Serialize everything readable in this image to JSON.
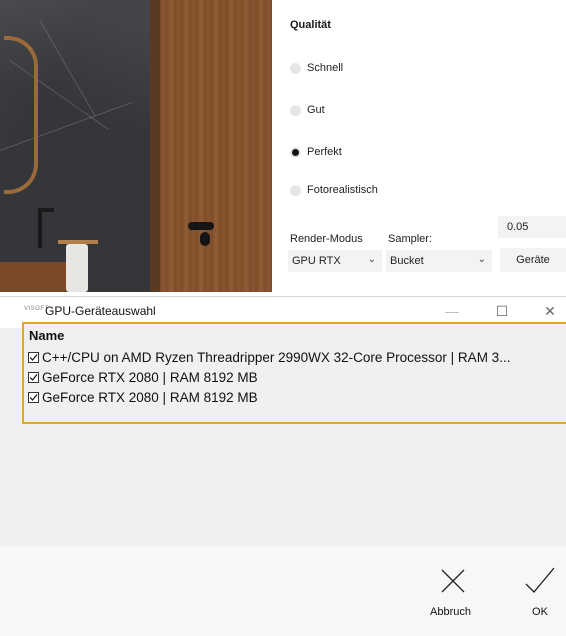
{
  "quality": {
    "title": "Qualität",
    "options": [
      {
        "label": "Schnell",
        "selected": false
      },
      {
        "label": "Gut",
        "selected": false
      },
      {
        "label": "Perfekt",
        "selected": true
      },
      {
        "label": "Fotorealistisch",
        "selected": false
      }
    ]
  },
  "render": {
    "mode_label": "Render-Modus",
    "mode_value": "GPU RTX",
    "sampler_label": "Sampler:",
    "sampler_value": "Bucket",
    "value_field": "0.05",
    "devices_button": "Geräte"
  },
  "dialog": {
    "app_icon_text": "VISOFT",
    "title": "GPU-Geräteauswahl",
    "controls": {
      "minimize": "—",
      "maximize": "☐",
      "close": "✕"
    },
    "column_header": "Name",
    "devices": [
      {
        "label": "C++/CPU on AMD Ryzen Threadripper 2990WX 32-Core Processor | RAM 3...",
        "checked": true
      },
      {
        "label": "GeForce RTX 2080 | RAM 8192 MB",
        "checked": true
      },
      {
        "label": "GeForce RTX 2080 | RAM 8192 MB",
        "checked": true
      }
    ],
    "cancel_label": "Abbruch",
    "ok_label": "OK"
  },
  "colors": {
    "highlight_border": "#e8a23a",
    "list_background": "#f0f0f0"
  }
}
